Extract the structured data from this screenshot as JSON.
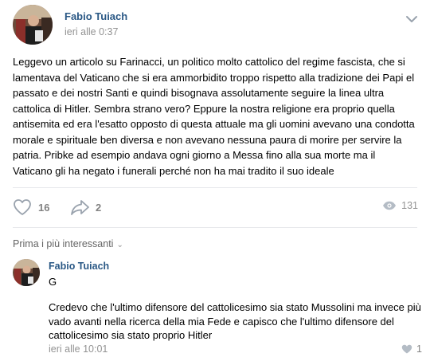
{
  "post": {
    "author": "Fabio Tuiach",
    "date": "ieri alle 0:37",
    "text": "Leggevo un articolo su Farinacci, un politico molto cattolico del regime fascista, che si lamentava del Vaticano che si era ammorbidito troppo rispetto alla tradizione dei Papi el passato e dei nostri Santi e quindi bisognava assolutamente seguire la linea ultra cattolica di Hitler. Sembra strano vero? Eppure la nostra religione era proprio quella antisemita ed era l'esatto opposto di questa attuale ma gli uomini avevano una condotta morale e spirituale ben diversa e non avevano nessuna paura di morire per servire la patria. Pribke ad esempio andava ogni giorno a Messa fino alla sua morte ma il Vaticano gli ha negato i funerali perché non ha mai tradito il suo ideale",
    "likes": "16",
    "shares": "2",
    "views": "131"
  },
  "comments_sort": {
    "label": "Prima i più interessanti"
  },
  "comment": {
    "author": "Fabio Tuiach",
    "first_line": "G",
    "text": "Credevo che l'ultimo difensore del cattolicesimo sia stato Mussolini ma invece più vado avanti nella ricerca della mia Fede e capisco che l'ultimo difensore del cattolicesimo sia stato proprio Hitler",
    "date": "ieri alle 10:01",
    "likes": "1"
  },
  "colors": {
    "link": "#2a5885",
    "muted": "#939393",
    "icon": "#99a2ad",
    "divider": "#e7e8ec"
  },
  "icons": [
    "avatar",
    "chevron-down-icon",
    "heart-icon",
    "share-arrow-icon",
    "eye-icon"
  ]
}
